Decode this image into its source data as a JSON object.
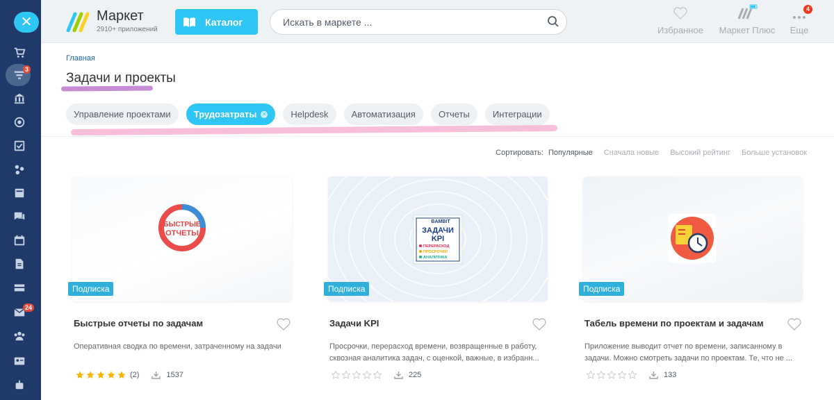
{
  "header": {
    "logo_title": "Маркет",
    "logo_subtitle": "2910+ приложений",
    "catalog_label": "Каталог",
    "search_placeholder": "Искать в маркете ...",
    "favorites_label": "Избранное",
    "market_plus_label": "Маркет Плюс",
    "more_label": "Еще",
    "more_badge": "4"
  },
  "sidebar": {
    "close_icon": "close-icon",
    "badge_filter": "3",
    "badge_mail": "24"
  },
  "breadcrumb": "Главная",
  "page_title": "Задачи и проекты",
  "tabs": [
    {
      "label": "Управление проектами"
    },
    {
      "label": "Трудозатраты",
      "active": true
    },
    {
      "label": "Helpdesk"
    },
    {
      "label": "Автоматизация"
    },
    {
      "label": "Отчеты"
    },
    {
      "label": "Интеграции"
    }
  ],
  "sort": {
    "label": "Сортировать:",
    "options": [
      "Популярные",
      "Сначала новые",
      "Высокий рейтинг",
      "Больше установок"
    ],
    "selected": "Популярные"
  },
  "cards": [
    {
      "badge": "Подписка",
      "name": "Быстрые отчеты по задачам",
      "description": "Оперативная сводка по времени, затраченному на задачи",
      "rating": 5,
      "rating_count": "(2)",
      "installs": "1537",
      "logo_line1": "БЫСТРЫЕ",
      "logo_line2": "ОТЧЕТЫ"
    },
    {
      "badge": "Подписка",
      "name": "Задачи KPI",
      "description": "Просрочки, перерасход времени, возвращенные в работу, сквозная аналитика задач, с оценкой, важные, в избранн...",
      "rating": 0,
      "rating_count": "",
      "installs": "225",
      "logo_brand": "BAMBIT",
      "logo_line1": "ЗАДАЧИ",
      "logo_line2": "KPI",
      "logo_items": [
        "ПЕРЕРАСХОД",
        "ПРОСРОЧКИ",
        "АНАЛИТИКА"
      ]
    },
    {
      "badge": "Подписка",
      "name": "Табель времени по проектам и задачам",
      "description": "Приложение выводит отчет по времени, записанному в задачи. Можно смотреть задачи по проектам. Те, что не ...",
      "rating": 0,
      "rating_count": "",
      "installs": "133"
    }
  ],
  "colors": {
    "accent": "#2fc6f6",
    "sidebar": "#1f3a69",
    "badge": "#2fb0db",
    "star": "#f7b500"
  }
}
